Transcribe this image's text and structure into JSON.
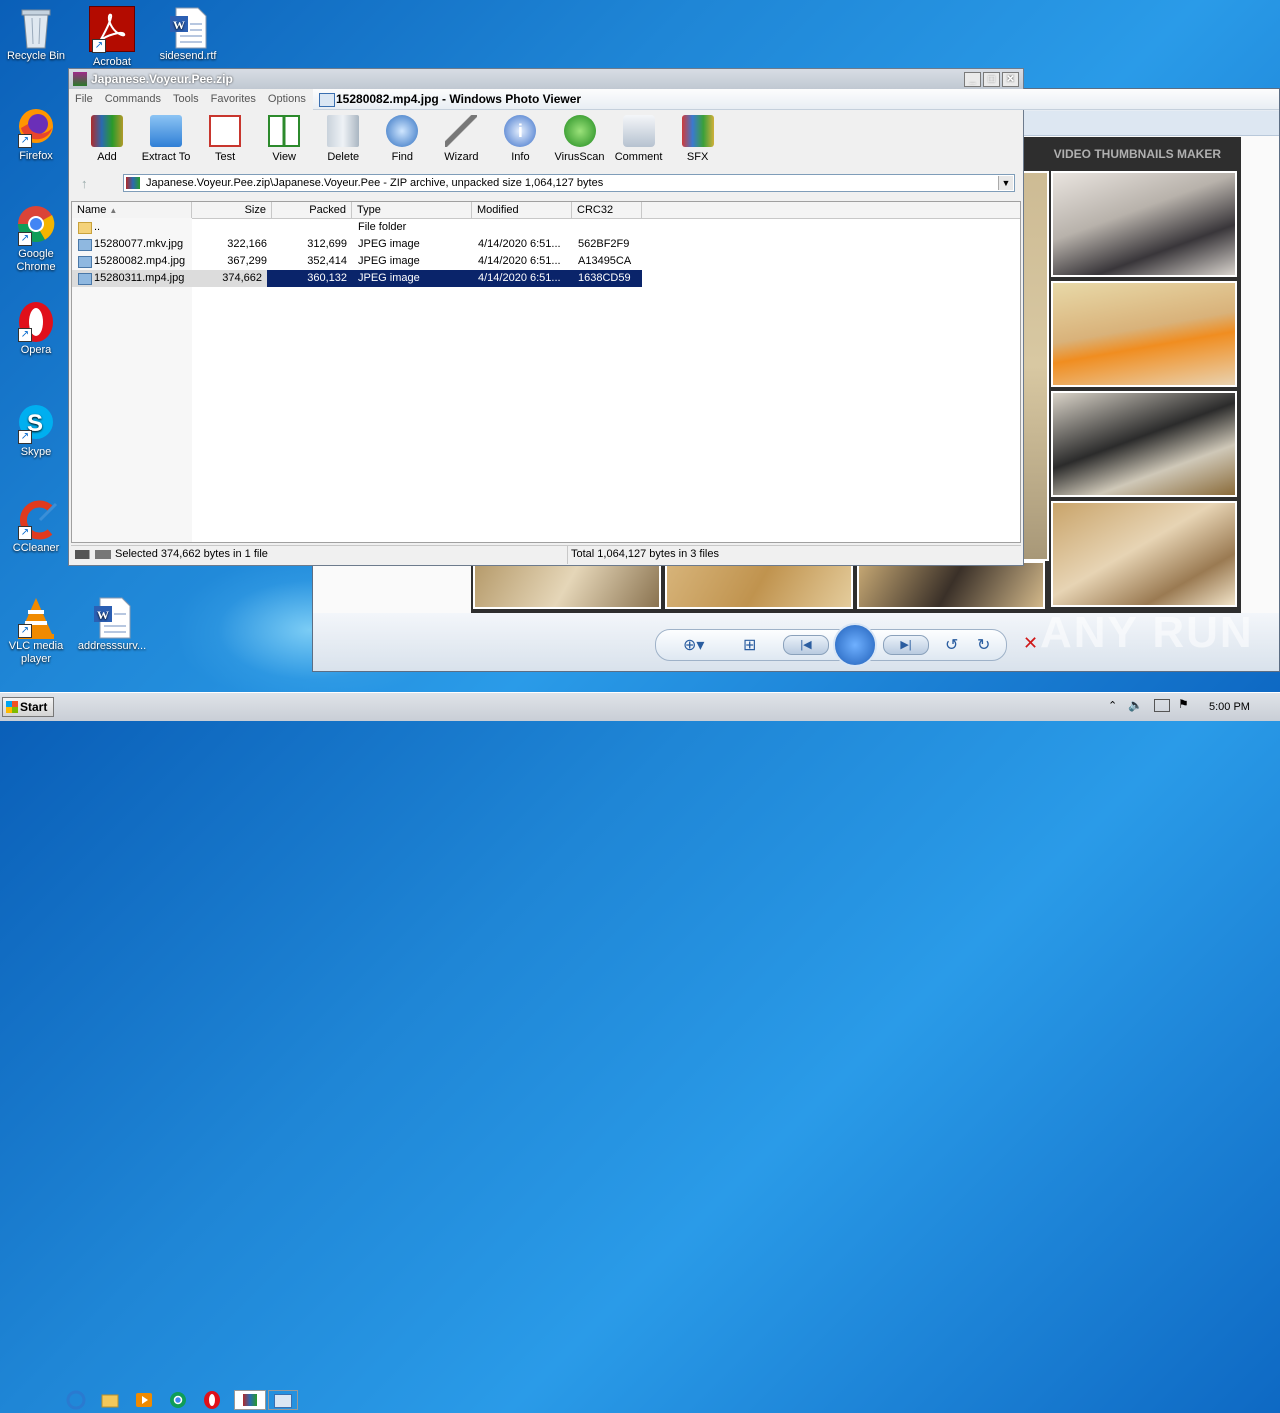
{
  "desktop": {
    "icons": [
      {
        "label": "Recycle Bin",
        "icon": "recycle-bin-icon"
      },
      {
        "label": "Acrobat",
        "icon": "acrobat-icon"
      },
      {
        "label": "sidesend.rtf",
        "icon": "word-document-icon"
      },
      {
        "label": "Firefox",
        "icon": "firefox-icon"
      },
      {
        "label": "Google Chrome",
        "icon": "chrome-icon"
      },
      {
        "label": "Opera",
        "icon": "opera-icon"
      },
      {
        "label": "Skype",
        "icon": "skype-icon"
      },
      {
        "label": "CCleaner",
        "icon": "ccleaner-icon"
      },
      {
        "label": "VLC media player",
        "icon": "vlc-icon"
      },
      {
        "label": "addresssurv...",
        "icon": "word-document-icon"
      }
    ]
  },
  "winrar": {
    "title": "Japanese.Voyeur.Pee.zip",
    "menu": [
      "File",
      "Commands",
      "Tools",
      "Favorites",
      "Options"
    ],
    "toolbar": [
      "Add",
      "Extract To",
      "Test",
      "View",
      "Delete",
      "Find",
      "Wizard",
      "Info",
      "VirusScan",
      "Comment",
      "SFX"
    ],
    "path": "Japanese.Voyeur.Pee.zip\\Japanese.Voyeur.Pee - ZIP archive, unpacked size 1,064,127 bytes",
    "columns": [
      "Name",
      "Size",
      "Packed",
      "Type",
      "Modified",
      "CRC32"
    ],
    "rows": [
      {
        "name": "..",
        "size": "",
        "packed": "",
        "type": "File folder",
        "modified": "",
        "crc": ""
      },
      {
        "name": "15280077.mkv.jpg",
        "size": "322,166",
        "packed": "312,699",
        "type": "JPEG image",
        "modified": "4/14/2020 6:51...",
        "crc": "562BF2F9"
      },
      {
        "name": "15280082.mp4.jpg",
        "size": "367,299",
        "packed": "352,414",
        "type": "JPEG image",
        "modified": "4/14/2020 6:51...",
        "crc": "A13495CA"
      },
      {
        "name": "15280311.mp4.jpg",
        "size": "374,662",
        "packed": "360,132",
        "type": "JPEG image",
        "modified": "4/14/2020 6:51...",
        "crc": "1638CD59"
      }
    ],
    "status_left": "Selected 374,662 bytes in 1 file",
    "status_right": "Total 1,064,127 bytes in 3 files"
  },
  "photoviewer": {
    "title": "15280082.mp4.jpg - Windows Photo Viewer",
    "image_heading": "VIDEO THUMBNAILS MAKER"
  },
  "taskbar": {
    "start_label": "Start",
    "time": "5:00 PM"
  },
  "watermark": "ANY RUN"
}
